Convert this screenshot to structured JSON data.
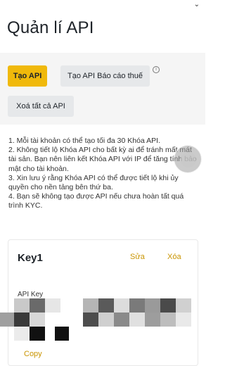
{
  "page": {
    "title": "Quản lí API"
  },
  "actions": {
    "create_api": "Tạo API",
    "create_tax_api": "Tạo API Báo cáo thuế",
    "delete_all": "Xoá tất cả API",
    "info_glyph": "i"
  },
  "notes": [
    "1. Mỗi tài khoản có thể tạo tối đa 30 Khóa API.",
    "2. Không tiết lộ Khóa API cho bất kỳ ai để tránh mất mát tài sản. Bạn nên liên kết Khóa API với IP để tăng tính bảo mật cho tài khoản.",
    "3. Xin lưu ý rằng Khóa API có thể được tiết lộ khi ủy quyền cho nền tảng bên thứ ba.",
    "4. Bạn sẽ không tạo được API nếu chưa hoàn tất quá trình KYC."
  ],
  "key_card": {
    "name": "Key1",
    "edit": "Sửa",
    "delete": "Xóa",
    "api_key_label": "API Key",
    "copy": "Copy"
  },
  "icons": {
    "status_chevron": "chevron-down-icon",
    "info": "info-icon"
  },
  "colors": {
    "accent": "#f0b90b",
    "link": "#c99400",
    "secondary_button": "#e6e8ea",
    "band": "#f5f5f5"
  }
}
